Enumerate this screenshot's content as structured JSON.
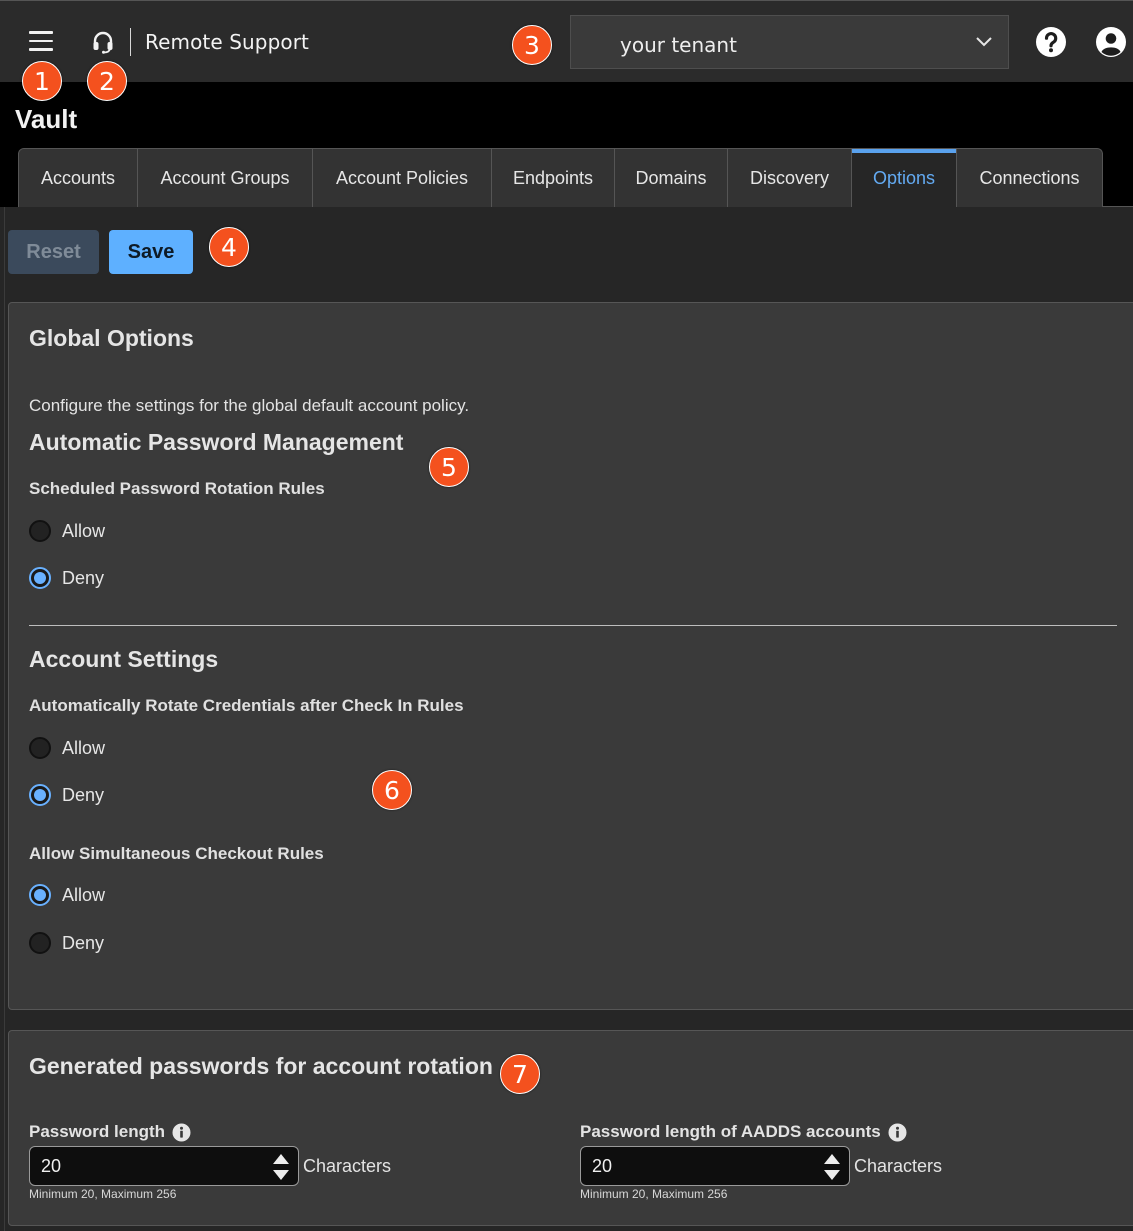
{
  "topbar": {
    "app_title": "Remote Support",
    "tenant_value": "your tenant",
    "icons": {
      "menu": "hamburger-menu-icon",
      "app": "headset-icon",
      "tenant_chevron": "chevron-down-icon",
      "help": "help-circle-icon",
      "user": "user-account-icon"
    }
  },
  "page": {
    "title": "Vault"
  },
  "tabs": [
    {
      "label": "Accounts"
    },
    {
      "label": "Account Groups"
    },
    {
      "label": "Account Policies"
    },
    {
      "label": "Endpoints"
    },
    {
      "label": "Domains"
    },
    {
      "label": "Discovery"
    },
    {
      "label": "Options",
      "active": true
    },
    {
      "label": "Connections"
    }
  ],
  "actions": {
    "reset_label": "Reset",
    "save_label": "Save"
  },
  "global_options": {
    "title": "Global Options",
    "description": "Configure the settings for the global default account policy.",
    "apm": {
      "title": "Automatic Password Management",
      "scheduled_rotation": {
        "label": "Scheduled Password Rotation Rules",
        "allow": "Allow",
        "deny": "Deny",
        "selected": "Deny"
      }
    },
    "account_settings": {
      "title": "Account Settings",
      "auto_rotate": {
        "label": "Automatically Rotate Credentials after Check In Rules",
        "allow": "Allow",
        "deny": "Deny",
        "selected": "Deny"
      },
      "simultaneous_checkout": {
        "label": "Allow Simultaneous Checkout Rules",
        "allow": "Allow",
        "deny": "Deny",
        "selected": "Allow"
      }
    }
  },
  "generated_passwords": {
    "title": "Generated passwords for account rotation",
    "password_length": {
      "label": "Password length",
      "value": "20",
      "unit": "Characters",
      "hint": "Minimum 20, Maximum 256"
    },
    "aadds_password_length": {
      "label": "Password length of AADDS accounts",
      "value": "20",
      "unit": "Characters",
      "hint": "Minimum 20, Maximum 256"
    }
  },
  "callouts": [
    "1",
    "2",
    "3",
    "4",
    "5",
    "6",
    "7"
  ],
  "colors": {
    "accent": "#5eb0ff",
    "callout": "#f4511e",
    "panel": "#3a3a3a",
    "topbar": "#2b2b2b"
  }
}
